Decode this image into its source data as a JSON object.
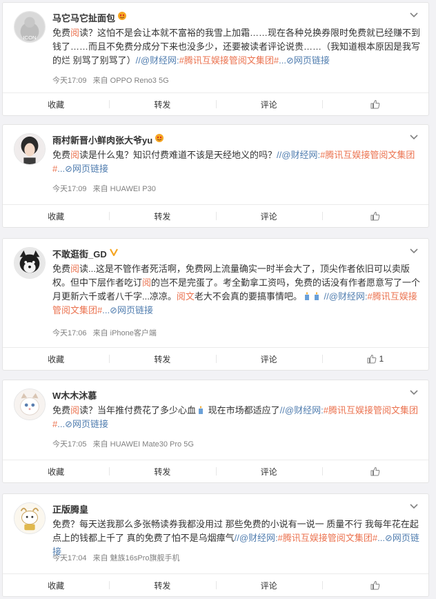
{
  "colors": {
    "page_bg": "#f2f2f5",
    "text": "#333333",
    "meta": "#808080",
    "highlight": "#eb7350",
    "link": "#507daf"
  },
  "actions": {
    "favorite": "收藏",
    "repost": "转发",
    "comment": "评论"
  },
  "posts": [
    {
      "username": "马它马它扯面包",
      "badge": "emoji-smile-icon",
      "text": [
        "免费",
        "阅",
        "读？这怕不是会让本就不富裕的我雪上加霜……现在各种兑换券限时免费就已经赚不到钱了……而且不免费分成分下来也没多少，还要被读者评论说贵……（我知道根本原因是我写的烂 别骂了别骂了）",
        "//@财经网:",
        "#腾讯互娱接管阅文集团#",
        "...",
        "网页链接"
      ],
      "time": "今天17:09",
      "source": "来自 OPPO Reno3 5G",
      "likes": ""
    },
    {
      "username": "雨村新晋小鲜肉张大爷yu",
      "badge": "emoji-smile-icon",
      "text": [
        "免费",
        "阅",
        "读是什么鬼？知识付费难道不该是天经地义的吗？",
        "//@财经网:",
        "#腾讯互娱接管阅文集团#",
        "...",
        "网页链接"
      ],
      "time": "今天17:09",
      "source": "来自 HUAWEI P30",
      "likes": ""
    },
    {
      "username": "不敢逛街_GD",
      "badge": "verified-v-icon",
      "text": [
        "免费",
        "阅",
        "读...这是不管作者死活啊，免费网上流量确实一时半会大了，顶尖作者依旧可以卖版权。但中下层作者吃订",
        "阅",
        "的岂不是完蛋了。考全勤拿工资吗，免费的话没有作者愿意写了一个月更新六千或者八千字...凉凉。",
        "阅文",
        "老大不会真的要搞事情吧。",
        "//@财经网:",
        "#腾讯互娱接管阅文集团#",
        "...",
        "网页链接"
      ],
      "time": "今天17:06",
      "source": "来自 iPhone客户端",
      "likes": "1"
    },
    {
      "username": "W木木沐慕",
      "badge": "",
      "text": [
        "免费",
        "阅",
        "读？当年推付费花了多少心血",
        "现在市场都适应了",
        "//@财经网:",
        "#腾讯互娱接管阅文集团#",
        "...",
        "网页链接"
      ],
      "time": "今天17:05",
      "source": "来自 HUAWEI Mate30 Pro 5G",
      "likes": ""
    },
    {
      "username": "正版腾皇",
      "badge": "",
      "text": [
        "免费？每天送我那么多张畅读券我都没用过 那些免费的小说有一说一 质量不行 我每年花在起点上的钱都上千了 真的免费了怕不是乌烟瘴气",
        "//@财经网:",
        "#腾讯互娱接管阅文集团#",
        "...",
        "网页链接"
      ],
      "time": "今天17:04",
      "source": "来自 魅族16sPro旗舰手机",
      "likes": ""
    }
  ]
}
